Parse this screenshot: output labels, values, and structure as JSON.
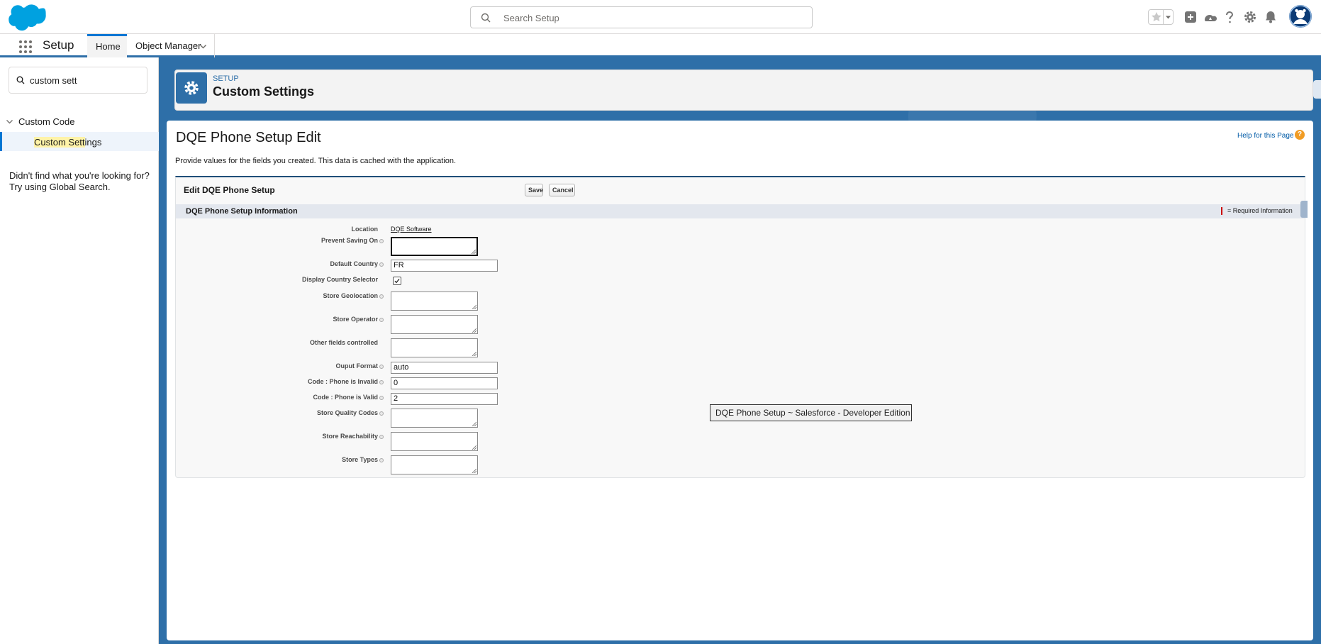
{
  "header": {
    "search_placeholder": "Search Setup",
    "icons": [
      "favorites-star-icon",
      "add-icon",
      "trailhead-icon",
      "help-icon",
      "gear-icon",
      "bell-icon",
      "avatar"
    ]
  },
  "app_nav": {
    "app_name": "Setup",
    "tabs": [
      {
        "label": "Home"
      },
      {
        "label": "Object Manager"
      }
    ]
  },
  "sidebar": {
    "quick_find_value": "custom sett",
    "tree_parent": "Custom Code",
    "tree_child_highlight": "Custom Sett",
    "tree_child_rest": "ings",
    "not_found_line1": "Didn't find what you're looking for?",
    "not_found_line2": "Try using Global Search."
  },
  "page_header": {
    "eyebrow": "SETUP",
    "title": "Custom Settings"
  },
  "edit": {
    "title": "DQE Phone Setup Edit",
    "help_link": "Help for this Page",
    "description": "Provide values for the fields you created. This data is cached with the application.",
    "block_title": "Edit DQE Phone Setup",
    "save_label": "Save",
    "cancel_label": "Cancel",
    "section_title": "DQE Phone Setup Information",
    "required_info": "= Required Information"
  },
  "fields": {
    "location_label": "Location",
    "location_value": "DQE Software",
    "prevent_saving_label": "Prevent Saving On",
    "default_country_label": "Default Country",
    "default_country_value": "FR",
    "display_country_label": "Display Country Selector",
    "display_country_checked": true,
    "store_geolocation_label": "Store Geolocation",
    "store_operator_label": "Store Operator",
    "other_fields_label": "Other fields controlled",
    "output_format_label": "Ouput Format",
    "output_format_value": "auto",
    "code_invalid_label": "Code : Phone is Invalid",
    "code_invalid_value": "0",
    "code_valid_label": "Code : Phone is Valid",
    "code_valid_value": "2",
    "store_quality_label": "Store Quality Codes",
    "store_reachability_label": "Store Reachability",
    "store_types_label": "Store Types"
  },
  "tooltip": "DQE Phone Setup ~ Salesforce - Developer Edition",
  "colors": {
    "brand": "#2e6fa8",
    "link": "#015ba7",
    "required": "#cc0000"
  }
}
